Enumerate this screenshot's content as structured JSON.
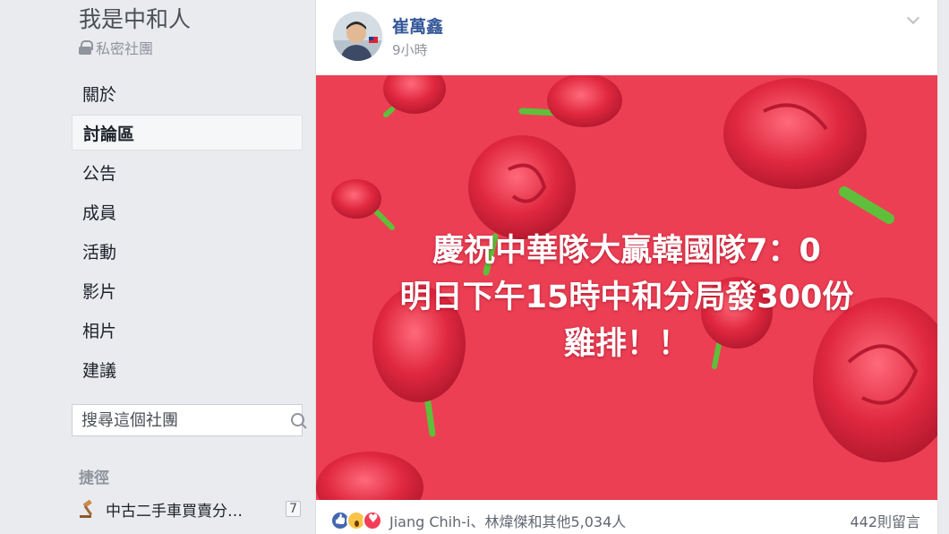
{
  "sidebar": {
    "group_name": "我是中和人",
    "privacy": "私密社團",
    "nav": [
      "關於",
      "討論區",
      "公告",
      "成員",
      "活動",
      "影片",
      "相片",
      "建議"
    ],
    "active_nav": "討論區",
    "search_placeholder": "搜尋這個社團",
    "shortcuts_title": "捷徑",
    "shortcut": {
      "label": "中古二手車買賣分…",
      "count": "7"
    }
  },
  "post": {
    "author": "崔萬鑫",
    "time": "9小時",
    "image_text": [
      "慶祝中華隊大贏韓國隊7：0",
      "明日下午15時中和分局發300份",
      "雞排！！"
    ],
    "reactions_text": "Jiang Chih-i、林煒傑和其他5,034人",
    "comments_text": "442則留言",
    "reaction_icons": [
      "like-icon",
      "wow-icon",
      "love-icon"
    ]
  },
  "colors": {
    "background": "#e9ebee",
    "link_blue": "#365899",
    "image_red": "#ec3f54",
    "rose_red": "#d9233b"
  }
}
